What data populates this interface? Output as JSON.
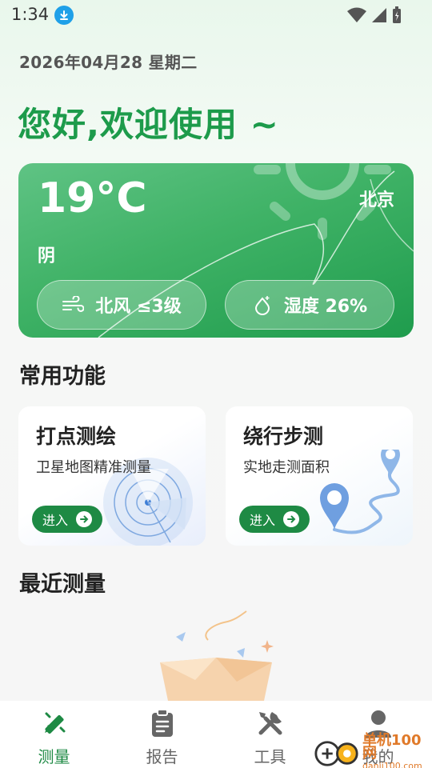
{
  "status_bar": {
    "time": "1:34"
  },
  "date": "2026年04月28  星期二",
  "greeting": "您好,欢迎使用 ~",
  "weather": {
    "temperature": "19°C",
    "condition": "阴",
    "city": "北京",
    "wind": "北风 ≤3级",
    "humidity": "湿度 26%"
  },
  "features": {
    "section_title": "常用功能",
    "items": [
      {
        "title": "打点测绘",
        "subtitle": "卫星地图精准测量",
        "button": "进入"
      },
      {
        "title": "绕行步测",
        "subtitle": "实地走测面积",
        "button": "进入"
      }
    ]
  },
  "recent": {
    "section_title": "最近测量"
  },
  "tabbar": {
    "items": [
      {
        "label": "测量",
        "icon": "ruler-pencil-icon",
        "active": true
      },
      {
        "label": "报告",
        "icon": "clipboard-icon",
        "active": false
      },
      {
        "label": "工具",
        "icon": "tools-icon",
        "active": false
      },
      {
        "label": "我的",
        "icon": "user-icon",
        "active": false
      }
    ]
  },
  "watermark": {
    "line1": "单机100网",
    "line2": "danji100.com"
  },
  "colors": {
    "accent": "#1e8a44",
    "greeting": "#1d9b4b",
    "weather_card": "#3fb266"
  }
}
